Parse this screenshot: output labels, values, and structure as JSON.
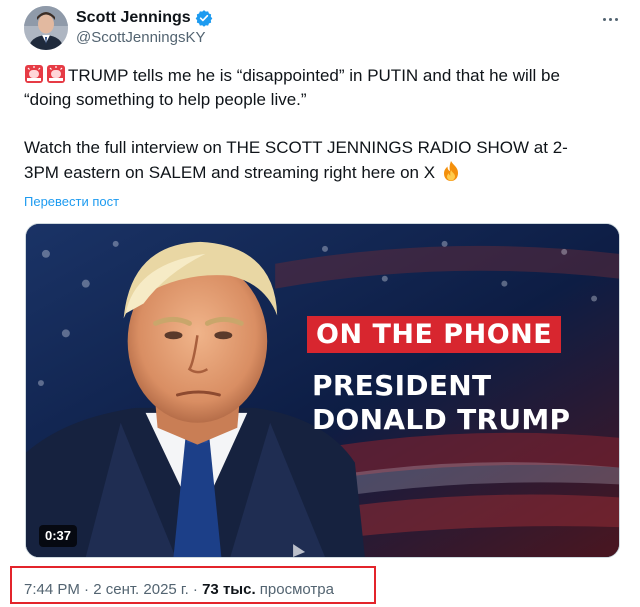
{
  "author": {
    "display_name": "Scott Jennings",
    "handle": "@ScottJenningsKY",
    "verified": true
  },
  "tweet": {
    "line1": "TRUMP tells me he is “disappointed” in PUTIN and that he will be",
    "line2": "“doing something to help people live.”",
    "line3": "Watch the full interview on THE SCOTT JENNINGS RADIO SHOW at 2-",
    "line4": "3PM eastern on SALEM and streaming right here on X",
    "translate_label": "Перевести пост"
  },
  "media": {
    "badge_text": "ON THE PHONE",
    "title_line1": "PRESIDENT",
    "title_line2": "DONALD TRUMP",
    "duration": "0:37"
  },
  "meta": {
    "time": "7:44 PM",
    "separator1": " · ",
    "date": "2 сент. 2025 г.",
    "separator2": " · ",
    "views_count": "73 тыс.",
    "views_label": " просмотра"
  },
  "icons": {
    "verified": "verified-badge-icon",
    "more": "more-options-icon",
    "siren": "police-light-emoji",
    "fire": "fire-emoji"
  },
  "colors": {
    "link": "#1d9bf0",
    "verified": "#1d9bf0",
    "highlight_box": "#e3242b",
    "badge_red": "#d8262f"
  }
}
